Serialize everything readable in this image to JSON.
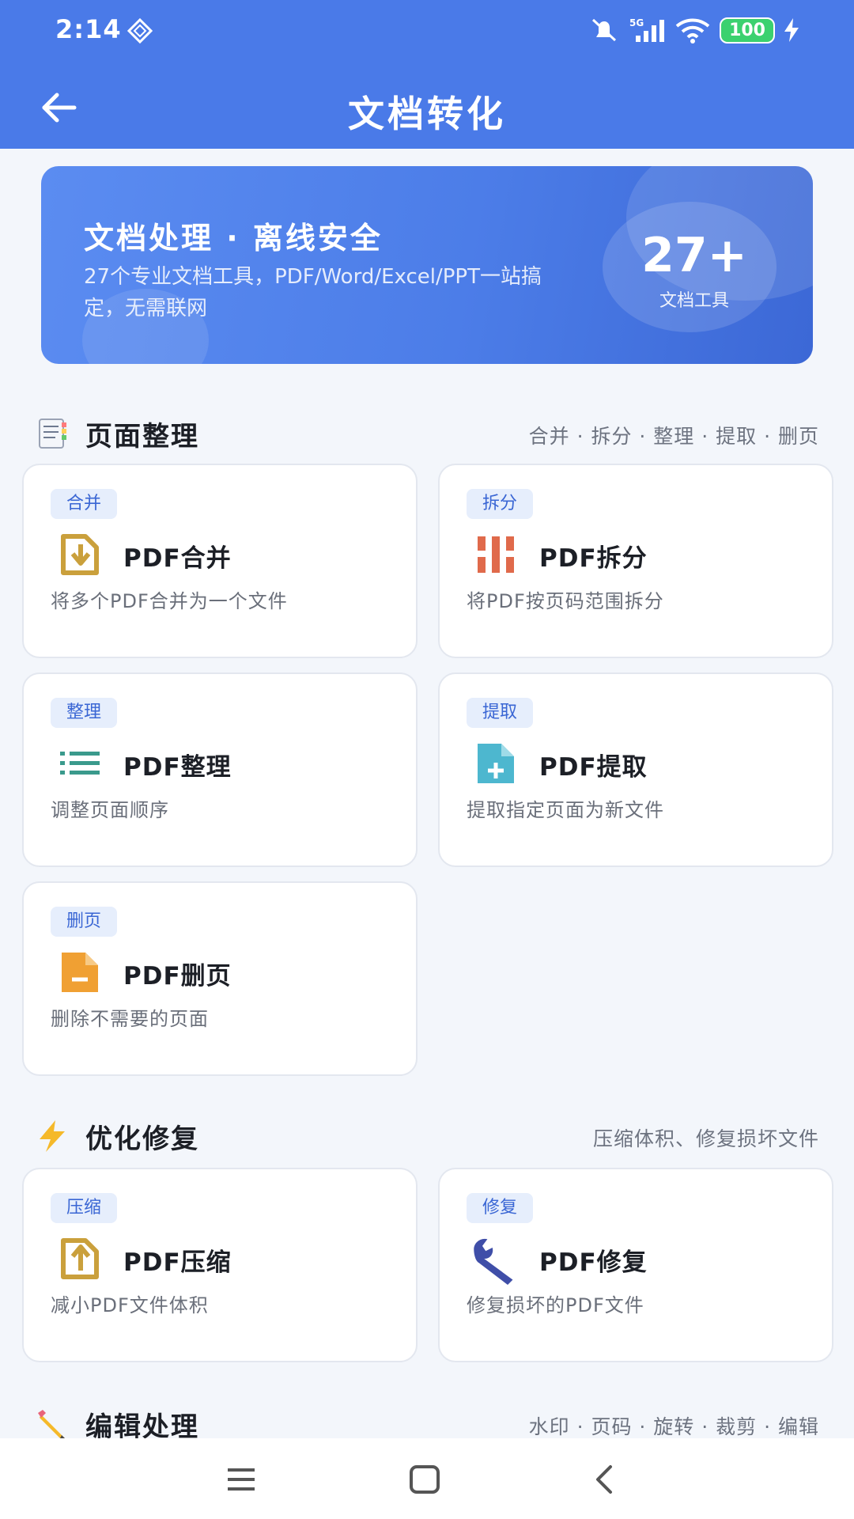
{
  "status_bar": {
    "time": "2:14",
    "battery": "100",
    "network": "5G"
  },
  "header": {
    "title": "文档转化"
  },
  "hero": {
    "title": "文档处理 · 离线安全",
    "description": "27个专业文档工具，PDF/Word/Excel/PPT一站搞定，无需联网",
    "count": "27+",
    "count_label": "文档工具"
  },
  "sections": [
    {
      "title": "页面整理",
      "subtitle": "合并 · 拆分 · 整理 · 提取 · 删页",
      "cards": [
        {
          "tag": "合并",
          "name": "PDF合并",
          "desc": "将多个PDF合并为一个文件",
          "icon": "merge-icon"
        },
        {
          "tag": "拆分",
          "name": "PDF拆分",
          "desc": "将PDF按页码范围拆分",
          "icon": "split-icon"
        },
        {
          "tag": "整理",
          "name": "PDF整理",
          "desc": "调整页面顺序",
          "icon": "list-icon"
        },
        {
          "tag": "提取",
          "name": "PDF提取",
          "desc": "提取指定页面为新文件",
          "icon": "file-add-icon"
        },
        {
          "tag": "删页",
          "name": "PDF删页",
          "desc": "删除不需要的页面",
          "icon": "file-remove-icon"
        }
      ]
    },
    {
      "title": "优化修复",
      "subtitle": "压缩体积、修复损坏文件",
      "cards": [
        {
          "tag": "压缩",
          "name": "PDF压缩",
          "desc": "减小PDF文件体积",
          "icon": "compress-icon"
        },
        {
          "tag": "修复",
          "name": "PDF修复",
          "desc": "修复损坏的PDF文件",
          "icon": "wrench-icon"
        }
      ]
    },
    {
      "title": "编辑处理",
      "subtitle": "水印 · 页码 · 旋转 · 裁剪 · 编辑"
    }
  ],
  "colors": {
    "primary": "#4a7ae8",
    "tag_bg": "#e6eefc",
    "tag_text": "#3a66d4"
  }
}
